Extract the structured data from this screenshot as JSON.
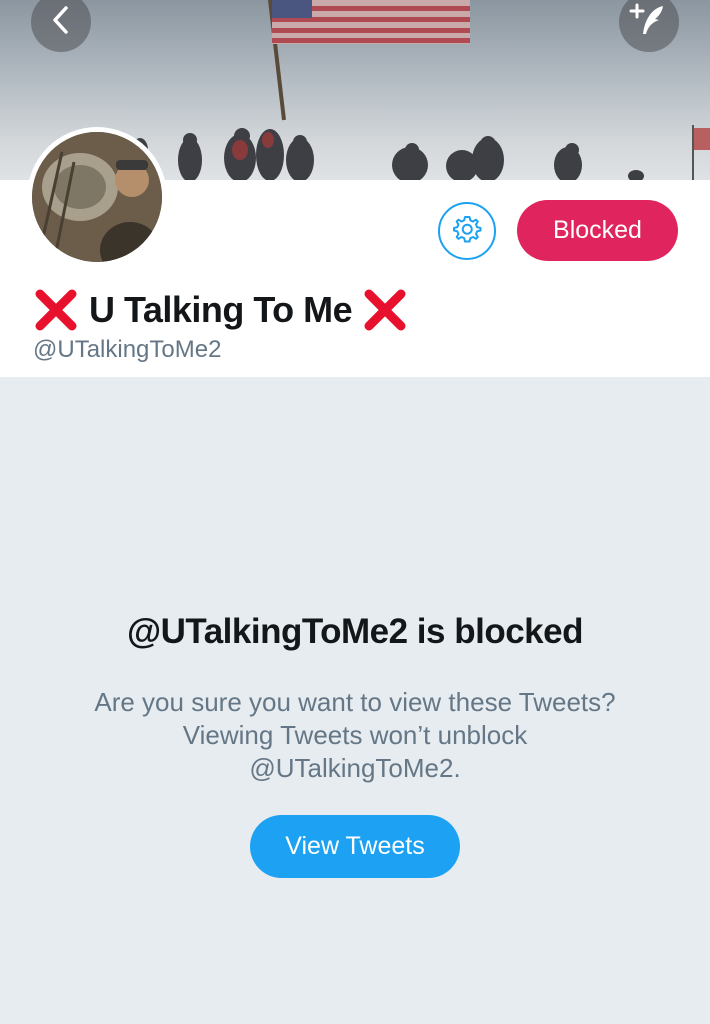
{
  "header": {
    "back_icon": "chevron-left-icon",
    "compose_icon": "compose-feather-icon"
  },
  "profile": {
    "display_name": "U Talking To Me",
    "name_decoration_icon": "red-x-icon",
    "handle": "@UTalkingToMe2",
    "settings_icon": "gear-icon",
    "blocked_label": "Blocked"
  },
  "blocked_notice": {
    "title": "@UTalkingToMe2 is blocked",
    "description": "Are you sure you want to view these Tweets? Viewing Tweets won’t unblock @UTalkingToMe2.",
    "view_tweets_label": "View Tweets"
  },
  "colors": {
    "accent_blue": "#1da1f2",
    "blocked_red": "#e0245e",
    "x_red": "#e8112d",
    "background": "#e6ecf0"
  }
}
